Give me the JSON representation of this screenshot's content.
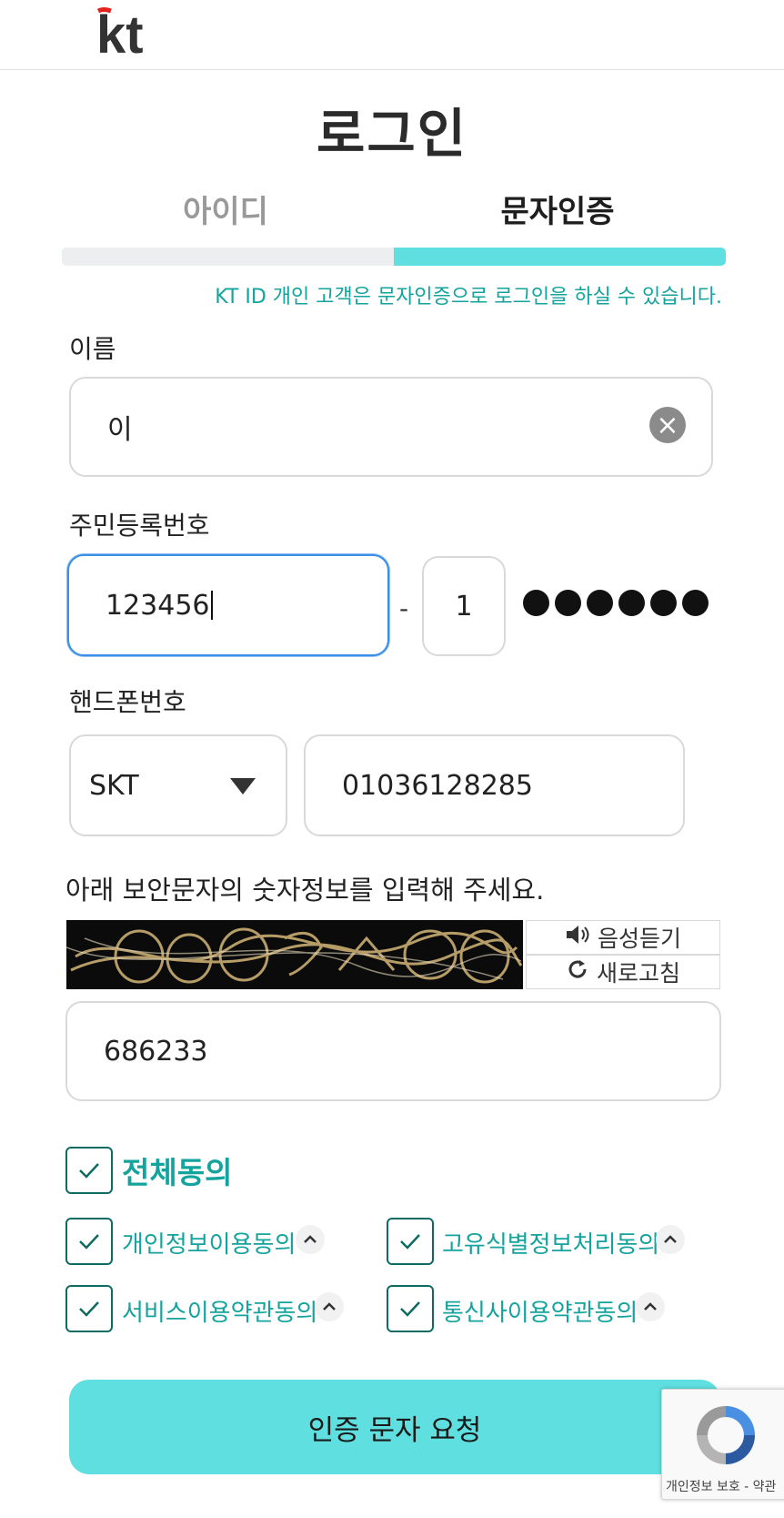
{
  "header": {
    "logo_text": "kt"
  },
  "page_title": "로그인",
  "tabs": [
    {
      "label": "아이디",
      "active": false
    },
    {
      "label": "문자인증",
      "active": true
    }
  ],
  "progress": {
    "fraction": 0.5
  },
  "notice": "KT ID 개인 고객은 문자인증으로 로그인을 하실 수 있습니다.",
  "name_field": {
    "label": "이름",
    "value": "이",
    "clear_icon": "close-icon"
  },
  "rrn": {
    "label": "주민등록번호",
    "front_value": "123456",
    "separator": "-",
    "back_first_digit": "1",
    "masked_count": 6
  },
  "phone": {
    "label": "핸드폰번호",
    "carrier": "SKT",
    "number": "01036128285"
  },
  "captcha": {
    "instruction": "아래 보안문자의 숫자정보를 입력해 주세요.",
    "listen_label": "음성듣기",
    "refresh_label": "새로고침",
    "input_value": "686233"
  },
  "agreements": {
    "all_label": "전체동의",
    "items": [
      {
        "label": "개인정보이용동의",
        "checked": true
      },
      {
        "label": "고유식별정보처리동의",
        "checked": true
      },
      {
        "label": "서비스이용약관동의",
        "checked": true
      },
      {
        "label": "통신사이용약관동의",
        "checked": true
      }
    ]
  },
  "submit_label": "인증 문자 요청",
  "recaptcha": {
    "links": "개인정보 보호 - 약관"
  },
  "colors": {
    "accent": "#5fdfe0",
    "accent_text": "#14a39d",
    "check_border": "#0e6b63",
    "focus": "#3a8fe8"
  }
}
